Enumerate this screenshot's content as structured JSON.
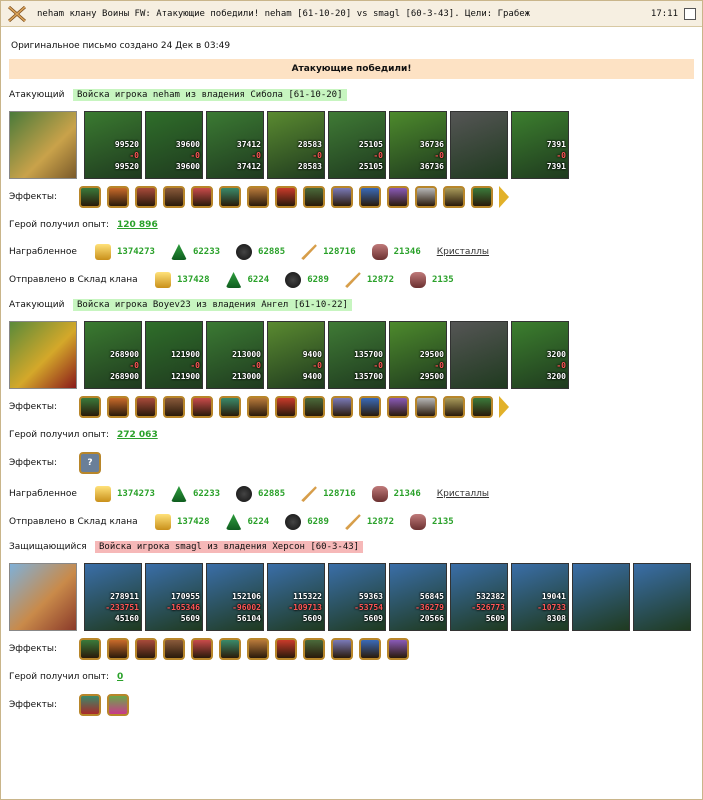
{
  "topbar": {
    "title": "neham клану Воины  FW: Атакующие победили! neham [61-10-20] vs smagl [60-3-43]. Цели: Грабеж",
    "time": "17:11"
  },
  "meta": {
    "created": "Оригинальное письмо создано 24 Дек в 03:49"
  },
  "banner": "Атакующие победили!",
  "attacker1": {
    "role": "Атакующий",
    "army": "Войска игрока neham из владения Сибола [61-10-20]",
    "units": [
      {
        "a": "99520",
        "b": "-0",
        "c": "99520",
        "color": "#3a7a30"
      },
      {
        "a": "39600",
        "b": "-0",
        "c": "39600",
        "color": "#2f6e2a"
      },
      {
        "a": "37412",
        "b": "-0",
        "c": "37412",
        "color": "#3b7a33"
      },
      {
        "a": "28583",
        "b": "-0",
        "c": "28583",
        "color": "#5a8a30"
      },
      {
        "a": "25105",
        "b": "-0",
        "c": "25105",
        "color": "#3f7a35"
      },
      {
        "a": "36736",
        "b": "-0",
        "c": "36736",
        "color": "#4d8a2c"
      },
      {
        "a": "",
        "b": "",
        "c": "",
        "color": "#555555"
      },
      {
        "a": "7391",
        "b": "-0",
        "c": "7391",
        "color": "#3c7f2e"
      }
    ],
    "effects_label": "Эффекты:",
    "exp_label": "Герой получил опыт:",
    "exp": "120 896",
    "loot_label": "Награбленное",
    "loot": [
      "1374273",
      "62233",
      "62885",
      "128716",
      "21346"
    ],
    "crystals": "Кристаллы",
    "sent_label": "Отправлено в Склад клана",
    "sent": [
      "137428",
      "6224",
      "6289",
      "12872",
      "2135"
    ]
  },
  "attacker2": {
    "role": "Атакующий",
    "army": "Войска игрока Boyev23 из владения Ангел [61-10-22]",
    "units": [
      {
        "a": "268900",
        "b": "-0",
        "c": "268900",
        "color": "#3a7a30"
      },
      {
        "a": "121900",
        "b": "-0",
        "c": "121900",
        "color": "#2f6e2a"
      },
      {
        "a": "213000",
        "b": "-0",
        "c": "213000",
        "color": "#3b7a33"
      },
      {
        "a": "9400",
        "b": "-0",
        "c": "9400",
        "color": "#5a8a30"
      },
      {
        "a": "135700",
        "b": "-0",
        "c": "135700",
        "color": "#3f7a35"
      },
      {
        "a": "29500",
        "b": "-0",
        "c": "29500",
        "color": "#4d8a2c"
      },
      {
        "a": "",
        "b": "",
        "c": "",
        "color": "#555555"
      },
      {
        "a": "3200",
        "b": "-0",
        "c": "3200",
        "color": "#3c7f2e"
      }
    ],
    "effects_label": "Эффекты:",
    "exp_label": "Герой получил опыт:",
    "exp": "272 063",
    "effects2_label": "Эффекты:",
    "loot_label": "Награбленное",
    "loot": [
      "1374273",
      "62233",
      "62885",
      "128716",
      "21346"
    ],
    "crystals": "Кристаллы",
    "sent_label": "Отправлено в Склад клана",
    "sent": [
      "137428",
      "6224",
      "6289",
      "12872",
      "2135"
    ]
  },
  "defender": {
    "role": "Защищающийся",
    "army": "Войска игрока smagl из владения Херсон [60-3-43]",
    "units": [
      {
        "a": "278911",
        "b": "-233751",
        "c": "45160",
        "color": "#3a6ea8"
      },
      {
        "a": "170955",
        "b": "-165346",
        "c": "5609",
        "color": "#3a6ea8"
      },
      {
        "a": "152106",
        "b": "-96002",
        "c": "56104",
        "color": "#3a6ea8"
      },
      {
        "a": "115322",
        "b": "-109713",
        "c": "5609",
        "color": "#3a6ea8"
      },
      {
        "a": "59363",
        "b": "-53754",
        "c": "5609",
        "color": "#3a6ea8"
      },
      {
        "a": "56845",
        "b": "-36279",
        "c": "20566",
        "color": "#3a6ea8"
      },
      {
        "a": "532382",
        "b": "-526773",
        "c": "5609",
        "color": "#3a6ea8"
      },
      {
        "a": "19041",
        "b": "-10733",
        "c": "8308",
        "color": "#3a6ea8"
      },
      {
        "a": "",
        "b": "",
        "c": "",
        "color": "#3a6ea8"
      },
      {
        "a": "",
        "b": "",
        "c": "",
        "color": "#3a6ea8"
      }
    ],
    "effects_label": "Эффекты:",
    "exp_label": "Герой получил опыт:",
    "exp": "0",
    "effects2_label": "Эффекты:"
  },
  "colors": {
    "green": "#2aa12a",
    "banner": "#fde2c4",
    "tag_green": "#c7f5c0",
    "tag_red": "#f6b8b8"
  }
}
